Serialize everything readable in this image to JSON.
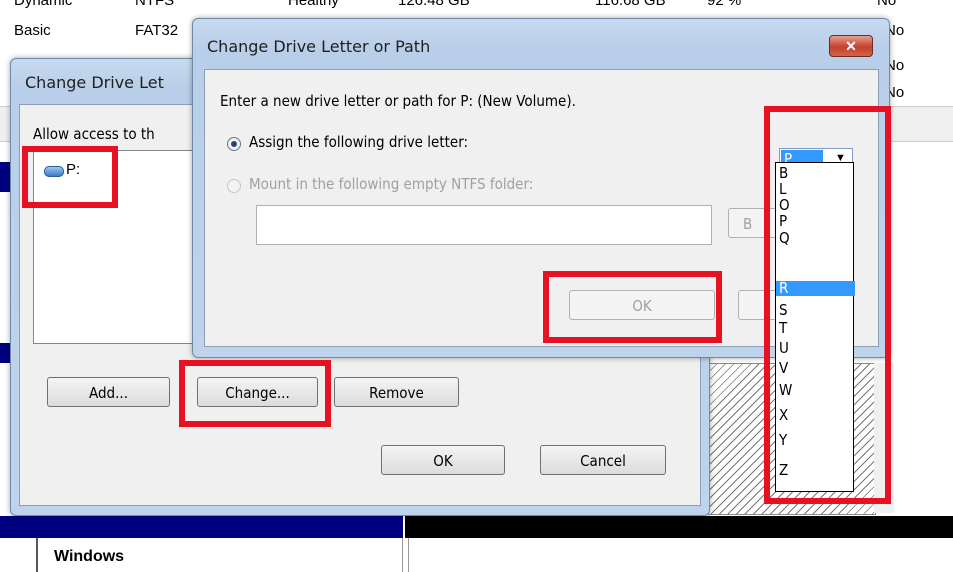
{
  "background": {
    "rows": [
      {
        "layout": "Dynamic",
        "type": "NTFS",
        "status": "Healthy",
        "capacity": "126.48 GB",
        "free": "116.68 GB",
        "pct": "92 %",
        "fault": "No"
      },
      {
        "layout": "Basic",
        "type": "FAT32",
        "status": "",
        "capacity": "",
        "free": "",
        "pct": "",
        "fault": "No"
      }
    ],
    "side_fault_values": [
      "No",
      "No"
    ],
    "bottom_disk_label": "Windows"
  },
  "access_dialog": {
    "title": "Change Drive Letter and Paths for P: (New Volume)",
    "title_visible": "Change Drive Let",
    "allow_text": "Allow access to this volume by using the following drive letter and paths:",
    "allow_visible": "Allow access to th",
    "entries": [
      "P:"
    ],
    "add_label": "Add...",
    "change_label": "Change...",
    "remove_label": "Remove",
    "ok_label": "OK",
    "cancel_label": "Cancel"
  },
  "change_dialog": {
    "title": "Change Drive Letter or Path",
    "close_glyph": "✕",
    "prompt": "Enter a new drive letter or path for P: (New Volume).",
    "assign_label": "Assign the following drive letter:",
    "mount_label": "Mount in the following empty NTFS folder:",
    "folder_value": "",
    "browse_label": "Browse...",
    "browse_visible": "B",
    "ok_label": "OK",
    "cancel_visible": "",
    "selected_letter": "P",
    "letters": [
      "B",
      "L",
      "O",
      "P",
      "Q",
      "R",
      "S",
      "T",
      "U",
      "V",
      "W",
      "X",
      "Y",
      "Z"
    ],
    "highlighted_letter": "R"
  },
  "colors": {
    "highlight": "#e81123",
    "selection": "#3399ff",
    "navy": "#000080"
  }
}
